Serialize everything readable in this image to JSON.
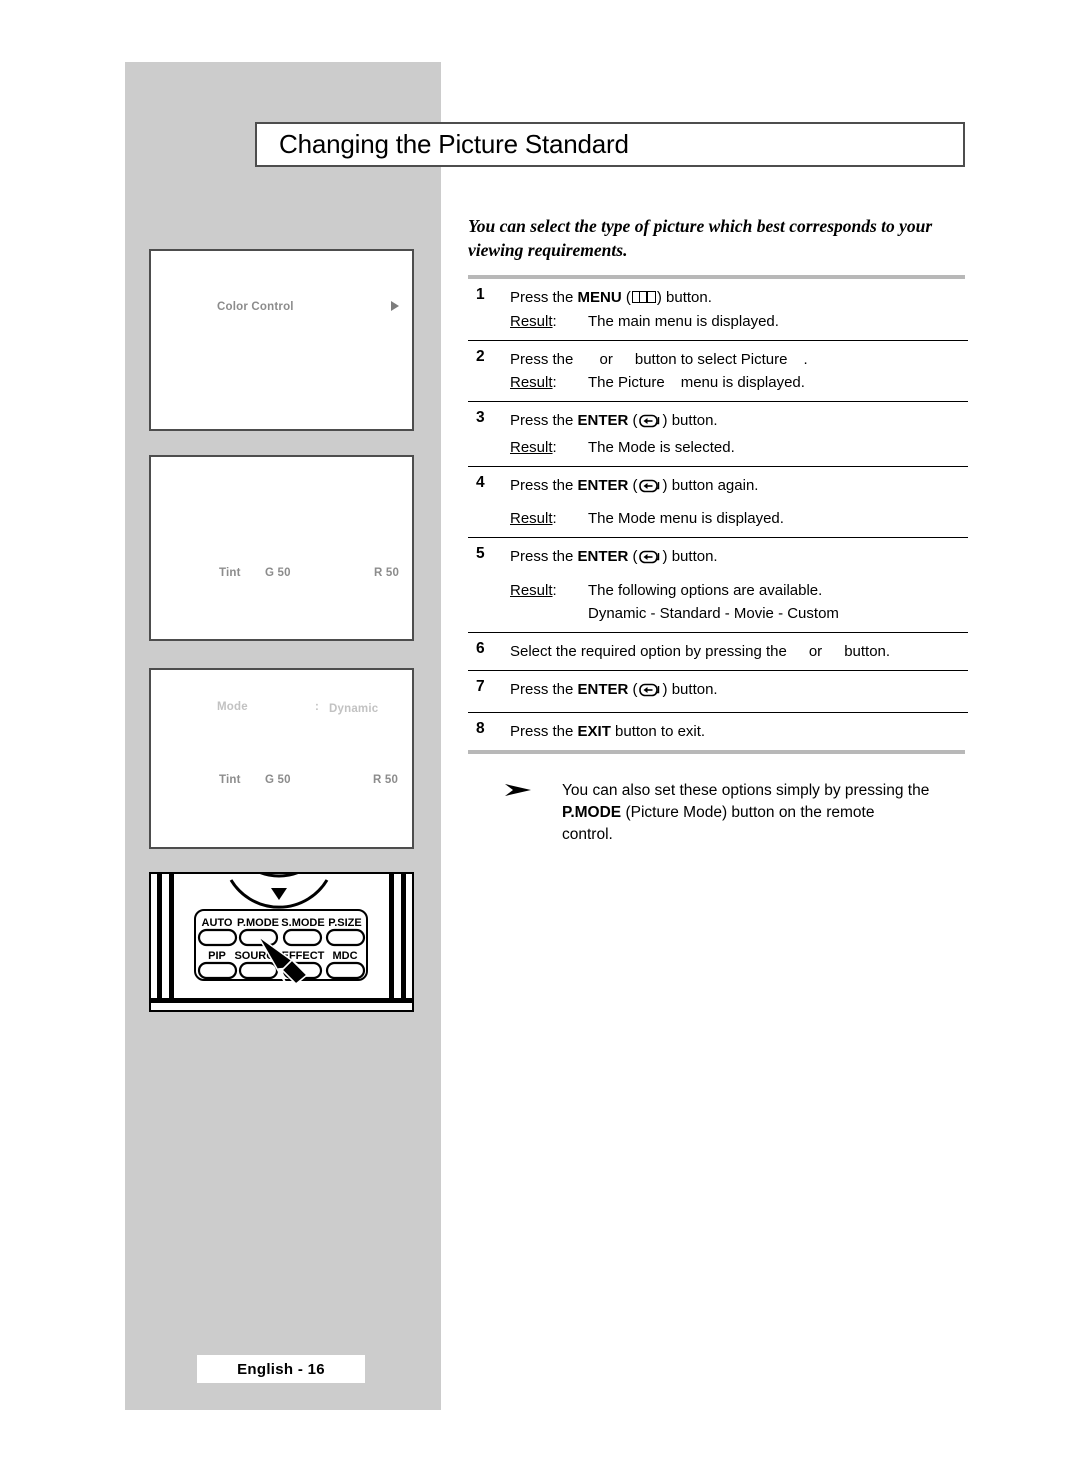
{
  "page": {
    "title": "Changing the Picture Standard",
    "intro": "You can select the type of picture which best corresponds to your viewing requirements.",
    "footer_label": "English - 16",
    "background_gray": "#cccccc",
    "border_gray": "#4d4d4d"
  },
  "osd_screens": [
    {
      "name": "color-control-screen",
      "items": [
        {
          "label": "Color Control",
          "style": "normal"
        }
      ],
      "arrow": "right-triangle"
    },
    {
      "name": "tint-screen",
      "items": [
        {
          "label": "Tint",
          "style": "normal"
        },
        {
          "label": "G 50",
          "style": "normal"
        },
        {
          "label": "R 50",
          "style": "normal"
        }
      ]
    },
    {
      "name": "mode-dynamic-screen",
      "items": [
        {
          "label": "Mode",
          "style": "faint"
        },
        {
          "label": ":",
          "style": "faint"
        },
        {
          "label": "Dynamic",
          "style": "faint"
        },
        {
          "label": "Tint",
          "style": "normal"
        },
        {
          "label": "G 50",
          "style": "normal"
        },
        {
          "label": "R 50",
          "style": "normal"
        }
      ]
    }
  ],
  "remote": {
    "buttons_row1": [
      "AUTO",
      "P.MODE",
      "S.MODE",
      "P.SIZE"
    ],
    "buttons_row2": [
      "PIP",
      "SOURCE",
      "EFFECT",
      "MDC"
    ],
    "cursor": "pointer-arrow",
    "highlighted_button": "P.MODE"
  },
  "steps": [
    {
      "num": "1",
      "pre": "Press the ",
      "bold": "MENU",
      "icon": "menu-icon",
      "post": " button.",
      "result_label": "Result",
      "result_text": "The main menu is displayed."
    },
    {
      "num": "2",
      "pre": "Press the ",
      "bold": "",
      "icon": "arrow-gap",
      "mid": "or",
      "post": "button to select Picture",
      "tail": ".",
      "result_label": "Result",
      "result_text": "The Picture",
      "result_text2": "menu is displayed."
    },
    {
      "num": "3",
      "pre": "Press the ",
      "bold": "ENTER",
      "icon": "enter-icon",
      "post": " button.",
      "result_label": "Result",
      "result_text": "The Mode is selected."
    },
    {
      "num": "4",
      "pre": "Press the ",
      "bold": "ENTER",
      "icon": "enter-icon",
      "post": " button again.",
      "result_label": "Result",
      "result_text": "The Mode menu is displayed."
    },
    {
      "num": "5",
      "pre": "Press the ",
      "bold": "ENTER",
      "icon": "enter-icon",
      "post": " button.",
      "result_label": "Result",
      "result_text": "The following options are available.",
      "options": "Dynamic  - Standard   - Movie  - Custom"
    },
    {
      "num": "6",
      "pre": "Select the required option by pressing the",
      "mid": "or",
      "post": "button."
    },
    {
      "num": "7",
      "pre": "Press the ",
      "bold": "ENTER",
      "icon": "enter-icon",
      "post": " button."
    },
    {
      "num": "8",
      "pre": "Press the ",
      "bold": "EXIT",
      "post": " button to exit."
    }
  ],
  "note": {
    "bullet": "arrow-bullet",
    "line1": "You can also set these options simply by pressing the",
    "bold": "P.MODE",
    "line2_rest": " (Picture Mode) button on the remote",
    "line3": "control."
  }
}
